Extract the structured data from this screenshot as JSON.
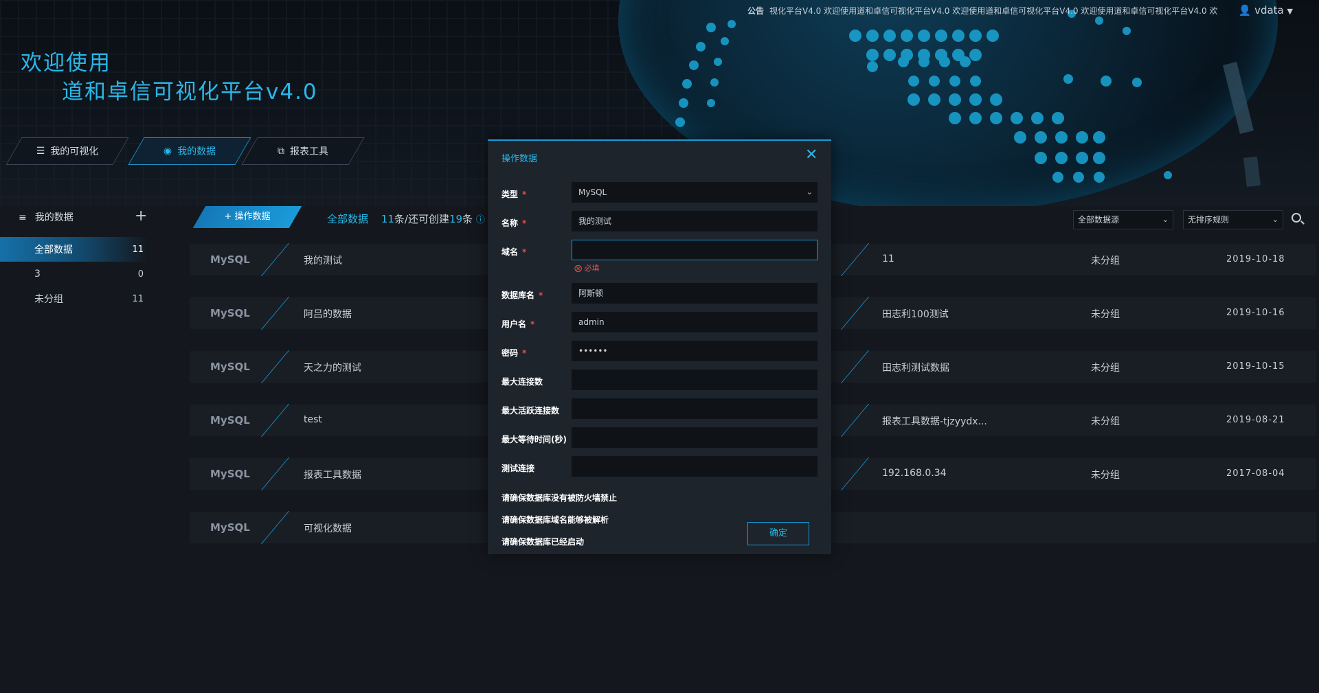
{
  "header": {
    "notice_label": "公告",
    "notice_text": "视化平台V4.0  欢迎使用道和卓信可视化平台V4.0  欢迎使用道和卓信可视化平台V4.0  欢迎使用道和卓信可视化平台V4.0  欢",
    "user_name": "vdata",
    "title_line1": "欢迎使用",
    "title_line2": "道和卓信可视化平台v4.0",
    "nav": [
      {
        "label": "我的可视化",
        "icon": "layers-icon"
      },
      {
        "label": "我的数据",
        "icon": "database-icon"
      },
      {
        "label": "报表工具",
        "icon": "copy-icon"
      }
    ]
  },
  "sidebar": {
    "title": "我的数据",
    "items": [
      {
        "label": "全部数据",
        "count": "11"
      },
      {
        "label": "3",
        "count": "0"
      },
      {
        "label": "未分组",
        "count": "11"
      }
    ]
  },
  "toolbar": {
    "op_button": "+ 操作数据",
    "crumb_all": "全部数据",
    "count_now": "11",
    "count_mid": "条/还可创建",
    "count_left": "19",
    "count_suffix": "条",
    "filter_source": "全部数据源",
    "filter_sort": "无排序规则"
  },
  "rows": [
    {
      "type": "MySQL",
      "name": "我的测试",
      "host": "11",
      "group": "未分组",
      "date": "2019-10-18"
    },
    {
      "type": "MySQL",
      "name": "阿吕的数据",
      "host": "田志利100测试",
      "group": "未分组",
      "date": "2019-10-16"
    },
    {
      "type": "MySQL",
      "name": "天之力的测试",
      "host": "田志利测试数据",
      "group": "未分组",
      "date": "2019-10-15"
    },
    {
      "type": "MySQL",
      "name": "test",
      "host": "报表工具数据-tjzyydx...",
      "group": "未分组",
      "date": "2019-08-21"
    },
    {
      "type": "MySQL",
      "name": "报表工具数据",
      "host": "192.168.0.34",
      "group": "未分组",
      "date": "2017-08-04"
    },
    {
      "type": "MySQL",
      "name": "可视化数据",
      "host": "",
      "group": "",
      "date": ""
    }
  ],
  "modal": {
    "title": "操作数据",
    "fields": [
      {
        "label": "类型",
        "value": "MySQL",
        "required": true
      },
      {
        "label": "名称",
        "value": "我的测试",
        "required": true
      },
      {
        "label": "域名",
        "value": "",
        "required": true
      },
      {
        "label": "数据库名",
        "value": "阿斯顿",
        "required": true
      },
      {
        "label": "用户名",
        "value": "admin",
        "required": true
      },
      {
        "label": "密码",
        "value": "••••••",
        "required": true
      },
      {
        "label": "最大连接数",
        "value": "",
        "required": false
      },
      {
        "label": "最大活跃连接数",
        "value": "",
        "required": false
      },
      {
        "label": "最大等待时间(秒)",
        "value": "",
        "required": false
      },
      {
        "label": "测试连接",
        "value": "",
        "required": false
      }
    ],
    "error_text": "必填",
    "notes": [
      "请确保数据库没有被防火墙禁止",
      "请确保数据库域名能够被解析",
      "请确保数据库已经启动"
    ],
    "confirm": "确定"
  },
  "colors": {
    "accent": "#2ab8e8",
    "error": "#e05050",
    "bg": "#14181e"
  }
}
